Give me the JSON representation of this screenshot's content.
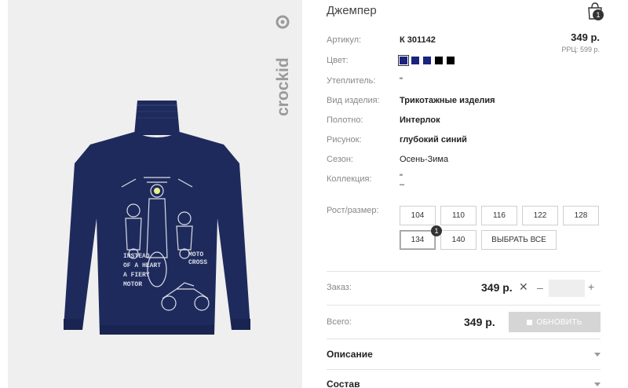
{
  "brand": {
    "logo_text": "crockid"
  },
  "product": {
    "title": "Джемпер",
    "cart_count": "1",
    "price": "349 р.",
    "rrp": "РРЦ: 599 р.",
    "print_text": [
      "INSTEAD",
      "OF A HEART",
      "A FIERY",
      "MOTOR"
    ],
    "print_text_right": [
      "MOTO",
      "CROSS"
    ],
    "garment_color": "#1f2a5c"
  },
  "attributes": [
    {
      "label": "Артикул:",
      "value": "К 301142"
    },
    {
      "label": "Цвет:",
      "value": ""
    },
    {
      "label": "Утеплитель:",
      "value": "\""
    },
    {
      "label": "Вид изделия:",
      "value": "Трикотажные изделия"
    },
    {
      "label": "Полотно:",
      "value": "Интерлок"
    },
    {
      "label": "Рисунок:",
      "value": "глубокий синий"
    },
    {
      "label": "Сезон:",
      "value": "Осень-Зима"
    },
    {
      "label": "Коллекция:",
      "value": "\"",
      "value2": "–"
    }
  ],
  "swatches": [
    "#1a237e",
    "#1a237e",
    "#1a237e",
    "#000000",
    "#000000"
  ],
  "sizes": {
    "label": "Рост/размер:",
    "options": [
      "104",
      "110",
      "116",
      "122",
      "128",
      "134",
      "140"
    ],
    "selected": "134",
    "selected_count": "1",
    "select_all": "ВЫБРАТЬ ВСЕ"
  },
  "order": {
    "label": "Заказ:",
    "price": "349 р.",
    "times": "✕",
    "minus": "–",
    "plus": "+",
    "qty": ""
  },
  "total": {
    "label": "Всего:",
    "price": "349 р.",
    "update_button": "ОБНОВИТЬ"
  },
  "accordion": [
    {
      "title": "Описание"
    },
    {
      "title": "Состав"
    }
  ]
}
